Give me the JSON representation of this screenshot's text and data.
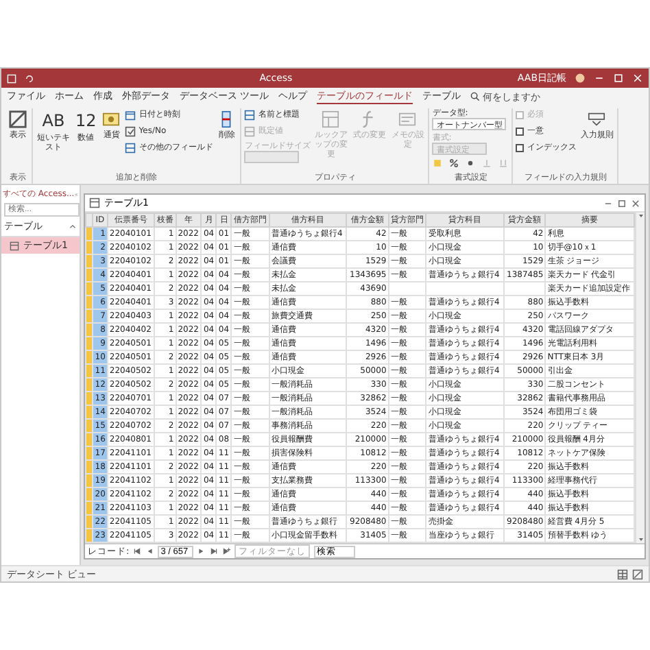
{
  "title_bar": {
    "title": "Access",
    "user": "AAB日記帳"
  },
  "ribbon_tabs": [
    {
      "label": "ファイル",
      "selected": false
    },
    {
      "label": "ホーム",
      "selected": false
    },
    {
      "label": "作成",
      "selected": false
    },
    {
      "label": "外部データ",
      "selected": false
    },
    {
      "label": "データベース ツール",
      "selected": false
    },
    {
      "label": "ヘルプ",
      "selected": false
    },
    {
      "label": "テーブルのフィールド",
      "selected": true
    },
    {
      "label": "テーブル",
      "selected": false
    }
  ],
  "tell_me": "何をしますか",
  "ribbon_groups": [
    {
      "label": "表示",
      "items": [
        {
          "kind": "large",
          "label": "表示",
          "disabled": false
        }
      ]
    },
    {
      "label": "追加と削除",
      "items": [
        {
          "kind": "glyph",
          "glyph": "AB",
          "label": "短いテキスト",
          "disabled": false
        },
        {
          "kind": "glyph",
          "glyph": "12",
          "label": "数値",
          "disabled": false
        },
        {
          "kind": "large",
          "label": "通貨",
          "disabled": false
        },
        {
          "kind": "column",
          "items": [
            {
              "kind": "small",
              "label": "日付と時刻",
              "disabled": false
            },
            {
              "kind": "small",
              "label": "Yes/No",
              "disabled": false
            },
            {
              "kind": "small",
              "label": "その他のフィールド",
              "disabled": false
            }
          ]
        },
        {
          "kind": "large",
          "label": "削除",
          "disabled": false
        }
      ]
    },
    {
      "label": "プロパティ",
      "items": [
        {
          "kind": "column",
          "items": [
            {
              "kind": "small",
              "label": "名前と標題",
              "disabled": false
            },
            {
              "kind": "small",
              "label": "既定値",
              "disabled": true
            },
            {
              "kind": "field",
              "label": "フィールドサイズ",
              "disabled": true
            }
          ]
        },
        {
          "kind": "large",
          "label": "ルックアップの変更",
          "disabled": true
        },
        {
          "kind": "large",
          "label": "式の変更",
          "disabled": true
        },
        {
          "kind": "large",
          "label": "メモの設定",
          "disabled": true
        }
      ]
    },
    {
      "label": "書式設定",
      "items": [
        {
          "kind": "column",
          "items": [
            {
              "kind": "field",
              "label": "データ型:",
              "value": "オートナンバー型",
              "disabled": false
            },
            {
              "kind": "field",
              "label": "書式:",
              "value": "書式設定",
              "disabled": true
            },
            {
              "kind": "icons",
              "items": [
                {
                  "disabled": false
                },
                {
                  "disabled": false
                },
                {
                  "disabled": false
                },
                {
                  "disabled": true
                },
                {
                  "disabled": true
                }
              ]
            }
          ]
        }
      ]
    },
    {
      "label": "フィールドの入力規則",
      "items": [
        {
          "kind": "column",
          "items": [
            {
              "kind": "check",
              "label": "必須",
              "checked": false,
              "disabled": true
            },
            {
              "kind": "check",
              "label": "一意",
              "checked": false,
              "disabled": false
            },
            {
              "kind": "check",
              "label": "インデックス",
              "checked": false,
              "disabled": false
            }
          ]
        },
        {
          "kind": "large",
          "label": "入力規則",
          "disabled": false
        }
      ]
    }
  ],
  "nav_pane": {
    "title": "すべての Access...",
    "search_placeholder": "検索...",
    "sections": [
      {
        "label": "テーブル",
        "expanded": true,
        "items": [
          {
            "label": "テーブル1",
            "selected": true
          }
        ]
      }
    ]
  },
  "table_window": {
    "title": "テーブル1",
    "columns": [
      "ID",
      "伝票番号",
      "枝番",
      "年",
      "月",
      "日",
      "借方部門",
      "借方科目",
      "借方金額",
      "貸方部門",
      "貸方科目",
      "貸方金額",
      "摘要"
    ],
    "rows": [
      [
        "1",
        "22040101",
        "1",
        "2022",
        "04",
        "01",
        "一般",
        "普通ゆうちょ銀行4",
        "42",
        "一般",
        "受取利息",
        "42",
        "利息"
      ],
      [
        "2",
        "22040102",
        "1",
        "2022",
        "04",
        "01",
        "一般",
        "通信費",
        "10",
        "一般",
        "小口現金",
        "10",
        "切手@10ｘ1"
      ],
      [
        "3",
        "22040102",
        "2",
        "2022",
        "04",
        "01",
        "一般",
        "会議費",
        "1529",
        "一般",
        "小口現金",
        "1529",
        "生茶 ジョージ"
      ],
      [
        "4",
        "22040401",
        "1",
        "2022",
        "04",
        "04",
        "一般",
        "未払金",
        "1343695",
        "一般",
        "普通ゆうちょ銀行4",
        "1387485",
        "楽天カード 代金引"
      ],
      [
        "5",
        "22040401",
        "2",
        "2022",
        "04",
        "04",
        "一般",
        "未払金",
        "43690",
        "",
        "",
        "",
        "楽天カード追加設定作"
      ],
      [
        "6",
        "22040401",
        "3",
        "2022",
        "04",
        "04",
        "一般",
        "通信費",
        "880",
        "一般",
        "普通ゆうちょ銀行4",
        "880",
        "振込手数料"
      ],
      [
        "7",
        "22040403",
        "1",
        "2022",
        "04",
        "04",
        "一般",
        "旅費交通費",
        "250",
        "一般",
        "小口現金",
        "250",
        "パスワーク"
      ],
      [
        "8",
        "22040402",
        "1",
        "2022",
        "04",
        "04",
        "一般",
        "通信費",
        "4320",
        "一般",
        "普通ゆうちょ銀行4",
        "4320",
        "電話回線アダプタ"
      ],
      [
        "9",
        "22040501",
        "1",
        "2022",
        "04",
        "05",
        "一般",
        "通信費",
        "1496",
        "一般",
        "普通ゆうちょ銀行4",
        "1496",
        "光電話利用料"
      ],
      [
        "10",
        "22040501",
        "2",
        "2022",
        "04",
        "05",
        "一般",
        "通信費",
        "2926",
        "一般",
        "普通ゆうちょ銀行4",
        "2926",
        "NTT東日本 3月"
      ],
      [
        "11",
        "22040502",
        "1",
        "2022",
        "04",
        "05",
        "一般",
        "小口現金",
        "50000",
        "一般",
        "普通ゆうちょ銀行4",
        "50000",
        "引出金"
      ],
      [
        "12",
        "22040502",
        "2",
        "2022",
        "04",
        "05",
        "一般",
        "一般消耗品",
        "330",
        "一般",
        "小口現金",
        "330",
        "二股コンセント"
      ],
      [
        "13",
        "22040701",
        "1",
        "2022",
        "04",
        "07",
        "一般",
        "一般消耗品",
        "32862",
        "一般",
        "小口現金",
        "32862",
        "書籍代事務用品"
      ],
      [
        "14",
        "22040702",
        "1",
        "2022",
        "04",
        "07",
        "一般",
        "一般消耗品",
        "3524",
        "一般",
        "小口現金",
        "3524",
        "布団用ゴミ袋"
      ],
      [
        "15",
        "22040702",
        "2",
        "2022",
        "04",
        "07",
        "一般",
        "事務消耗品",
        "220",
        "一般",
        "小口現金",
        "220",
        "クリップ ティー"
      ],
      [
        "16",
        "22040801",
        "1",
        "2022",
        "04",
        "08",
        "一般",
        "役員報酬費",
        "210000",
        "一般",
        "普通ゆうちょ銀行4",
        "210000",
        "役員報酬 4月分"
      ],
      [
        "17",
        "22041101",
        "1",
        "2022",
        "04",
        "11",
        "一般",
        "損害保険料",
        "10812",
        "一般",
        "普通ゆうちょ銀行4",
        "10812",
        "ネットケア保険"
      ],
      [
        "18",
        "22041101",
        "2",
        "2022",
        "04",
        "11",
        "一般",
        "通信費",
        "220",
        "一般",
        "普通ゆうちょ銀行4",
        "220",
        "振込手数料"
      ],
      [
        "19",
        "22041102",
        "1",
        "2022",
        "04",
        "11",
        "一般",
        "支払業務費",
        "113300",
        "一般",
        "普通ゆうちょ銀行4",
        "113300",
        "経理事務代行"
      ],
      [
        "20",
        "22041102",
        "2",
        "2022",
        "04",
        "11",
        "一般",
        "通信費",
        "440",
        "一般",
        "普通ゆうちょ銀行4",
        "440",
        "振込手数料"
      ],
      [
        "21",
        "22041103",
        "1",
        "2022",
        "04",
        "11",
        "一般",
        "通信費",
        "440",
        "一般",
        "普通ゆうちょ銀行4",
        "440",
        "振込手数料"
      ],
      [
        "22",
        "22041105",
        "1",
        "2022",
        "04",
        "11",
        "一般",
        "普通ゆうちょ銀行",
        "9208480",
        "一般",
        "売掛金",
        "9208480",
        "経営費 4月分 5"
      ],
      [
        "23",
        "22041105",
        "3",
        "2022",
        "04",
        "11",
        "一般",
        "小口現金留手数料",
        "31405",
        "一般",
        "当座ゆうちょ銀行",
        "31405",
        "預替手数料 ゆう"
      ]
    ],
    "record_nav": {
      "label": "レコード:",
      "position": "3 / 657",
      "filter": "フィルターなし",
      "search": "検索"
    }
  },
  "status_bar": {
    "text": "データシート ビュー"
  }
}
